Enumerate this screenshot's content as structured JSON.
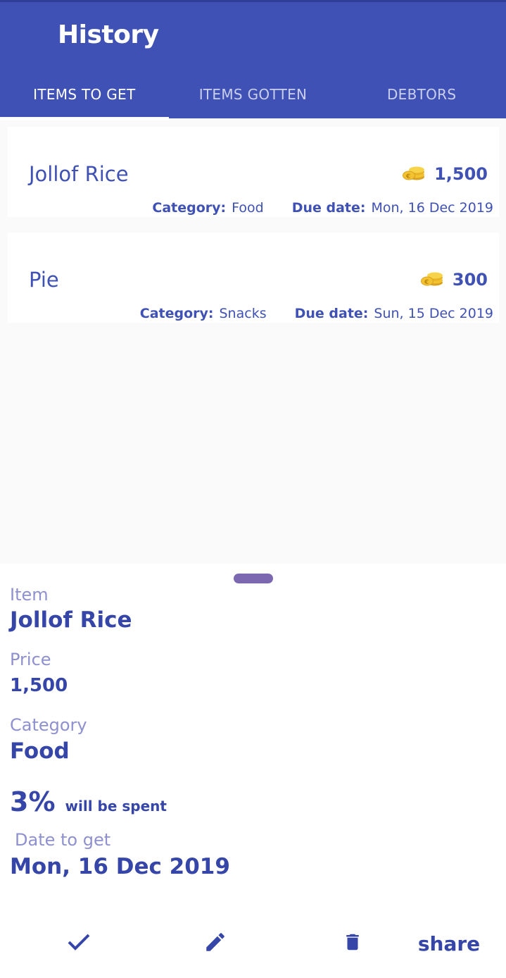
{
  "appbar": {
    "title": "History"
  },
  "tabs": [
    {
      "label": "ITEMS TO GET",
      "active": true
    },
    {
      "label": "ITEMS GOTTEN",
      "active": false
    },
    {
      "label": "DEBTORS",
      "active": false
    }
  ],
  "items": [
    {
      "name": "Jollof Rice",
      "price": "1,500",
      "category_label": "Category:",
      "category": "Food",
      "due_label": "Due date:",
      "due": "Mon, 16 Dec 2019"
    },
    {
      "name": "Pie",
      "price": "300",
      "category_label": "Category:",
      "category": "Snacks",
      "due_label": "Due date:",
      "due": "Sun, 15 Dec 2019"
    }
  ],
  "detail": {
    "item_label": "Item",
    "item_value": "Jollof Rice",
    "price_label": "Price",
    "price_value": "1,500",
    "category_label": "Category",
    "category_value": "Food",
    "percent": "3%",
    "percent_text": "will be spent",
    "date_label": "Date to get",
    "date_value": "Mon, 16 Dec 2019"
  },
  "actions": {
    "share_label": "share"
  },
  "icons": {
    "coins": "coins-icon",
    "check": "check-icon",
    "edit": "pencil-icon",
    "delete": "trash-icon"
  },
  "colors": {
    "primary": "#3f51b5",
    "text": "#3646a8",
    "label": "#8e90cf",
    "coin": "#f2c230",
    "handle": "#7b68b0"
  }
}
